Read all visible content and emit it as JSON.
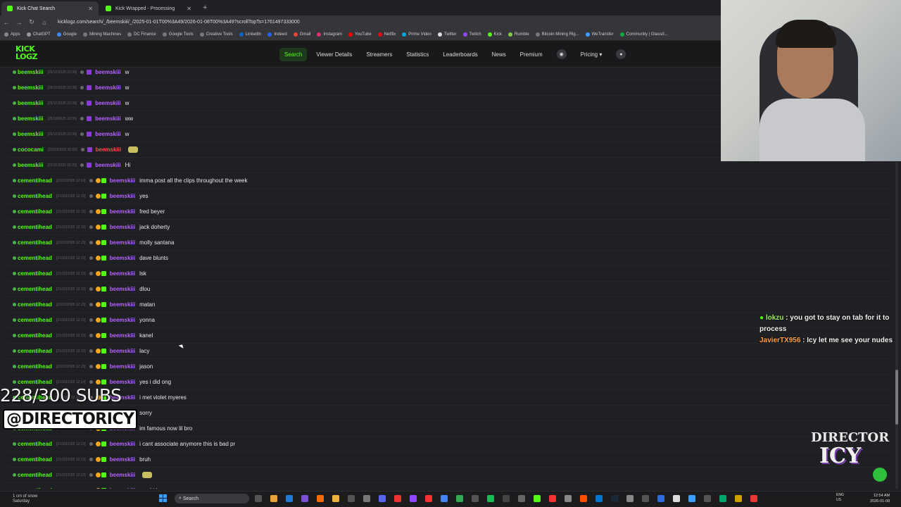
{
  "browser": {
    "tabs": [
      {
        "title": "Kick Chat Search",
        "close": "✕",
        "active": true
      },
      {
        "title": "Kick Wrapped - Processing",
        "close": "✕",
        "active": false
      }
    ],
    "new_tab": "+",
    "url": "kicklogz.com/search/_/beemskiii/_/2025-01-01T00%3A49/2026-01-08T00%3A49?scrollTopTs=1761497333000",
    "bookmarks": [
      "Apps",
      "ChatGPT",
      "Google",
      "Mining Machines",
      "DC Finance",
      "Google Tools",
      "Creative Tools",
      "LinkedIn",
      "Indeed",
      "Gmail",
      "Instagram",
      "YouTube",
      "Netflix",
      "Prime Video",
      "Twitter",
      "Twitch",
      "Kick",
      "Rumble",
      "Bitcoin Mining Rig...",
      "WeTransfer",
      "Community | Glassd..."
    ]
  },
  "site": {
    "logo_line1": "KICK",
    "logo_line2": "LOGZ",
    "nav": [
      "Search",
      "Viewer Details",
      "Streamers",
      "Statistics",
      "Leaderboards",
      "News",
      "Premium",
      "Pricing"
    ],
    "discord_icon": "discord-icon",
    "user_icon": "user-icon"
  },
  "chat": {
    "rows": [
      {
        "sender": "beemskiii",
        "ts": "[25/10/2025 22:05]",
        "target": "beemskiii",
        "msg": "w"
      },
      {
        "sender": "beemskiii",
        "ts": "[25/10/2025 22:05]",
        "target": "beemskiii",
        "msg": "w"
      },
      {
        "sender": "beemskiii",
        "ts": "[25/10/2025 22:05]",
        "target": "beemskiii",
        "msg": "w"
      },
      {
        "sender": "beemskiii",
        "ts": "[25/10/2025 22:05]",
        "target": "beemskiii",
        "msg": "ww"
      },
      {
        "sender": "beemskiii",
        "ts": "[25/10/2025 22:05]",
        "target": "beemskiii",
        "msg": "w"
      },
      {
        "sender": "cococami",
        "ts": "[25/10/2025 01:00]",
        "target": "beemskiii",
        "msg": ""
      },
      {
        "sender": "beemskiii",
        "ts": "[22/10/2025 00:20]",
        "target": "beemskiii",
        "msg": "Hi"
      },
      {
        "sender": "cementihead",
        "ts": "[21/10/2025 12:16]",
        "target": "beemskiii",
        "msg": "imma post all the clips throughout the week"
      },
      {
        "sender": "cementihead",
        "ts": "[21/10/2025 12:16]",
        "target": "beemskiii",
        "msg": "yes"
      },
      {
        "sender": "cementihead",
        "ts": "[21/10/2025 12:16]",
        "target": "beemskiii",
        "msg": "fred beyer"
      },
      {
        "sender": "cementihead",
        "ts": "[21/10/2025 12:16]",
        "target": "beemskiii",
        "msg": "jack doherty"
      },
      {
        "sender": "cementihead",
        "ts": "[21/10/2025 12:15]",
        "target": "beemskiii",
        "msg": "molly santana"
      },
      {
        "sender": "cementihead",
        "ts": "[21/10/2025 12:15]",
        "target": "beemskiii",
        "msg": "dave blunts"
      },
      {
        "sender": "cementihead",
        "ts": "[21/10/2025 12:15]",
        "target": "beemskiii",
        "msg": "lsk"
      },
      {
        "sender": "cementihead",
        "ts": "[21/10/2025 12:15]",
        "target": "beemskiii",
        "msg": "dlou"
      },
      {
        "sender": "cementihead",
        "ts": "[21/10/2025 12:15]",
        "target": "beemskiii",
        "msg": "matan"
      },
      {
        "sender": "cementihead",
        "ts": "[21/10/2025 12:15]",
        "target": "beemskiii",
        "msg": "yonna"
      },
      {
        "sender": "cementihead",
        "ts": "[21/10/2025 12:15]",
        "target": "beemskiii",
        "msg": "kanel"
      },
      {
        "sender": "cementihead",
        "ts": "[21/10/2025 12:15]",
        "target": "beemskiii",
        "msg": "lacy"
      },
      {
        "sender": "cementihead",
        "ts": "[21/10/2025 12:15]",
        "target": "beemskiii",
        "msg": "jason"
      },
      {
        "sender": "cementihead",
        "ts": "[21/10/2025 12:14]",
        "target": "beemskiii",
        "msg": "yes i did ong"
      },
      {
        "sender": "cementihead",
        "ts": "[21/10/2025 12:14]",
        "target": "beemskiii",
        "msg": "i met violet myeres"
      },
      {
        "sender": "cementihead",
        "ts": "[21/10/2025 12:14]",
        "target": "beemskiii",
        "msg": "sorry"
      },
      {
        "sender": "cementihead",
        "ts": "[21/10/2025 12:13]",
        "target": "beemskiii",
        "msg": "im famous now lil bro"
      },
      {
        "sender": "cementihead",
        "ts": "[21/10/2025 12:13]",
        "target": "beemskiii",
        "msg": "i cant associate anymore this is bad pr"
      },
      {
        "sender": "cementihead",
        "ts": "[21/10/2025 12:13]",
        "target": "beemskiii",
        "msg": "bruh"
      },
      {
        "sender": "cementihead",
        "ts": "[21/10/2025 12:12]",
        "target": "beemskiii",
        "msg": ""
      },
      {
        "sender": "cementihead",
        "ts": "[21/10/2025 12:12]",
        "target": "beemskiii",
        "msg": "sup kid"
      }
    ]
  },
  "overlay": {
    "chat1_name": "lokzu",
    "chat1_msg": ": you got to stay on tab for it to process",
    "chat2_name": "JavierTX956",
    "chat2_msg": ": Icy let me see your nudes",
    "subs": "228/300 SUBS",
    "handle": "@DIRECTORICY",
    "brand_line1": "DIRECTOR",
    "brand_line2": "ICY"
  },
  "taskbar": {
    "weather_line1": "1 cm of snow",
    "weather_line2": "Saturday",
    "search": "Search",
    "lang1": "ENG",
    "lang2": "US",
    "time": "12:54 AM",
    "date": "2026-01-08"
  }
}
